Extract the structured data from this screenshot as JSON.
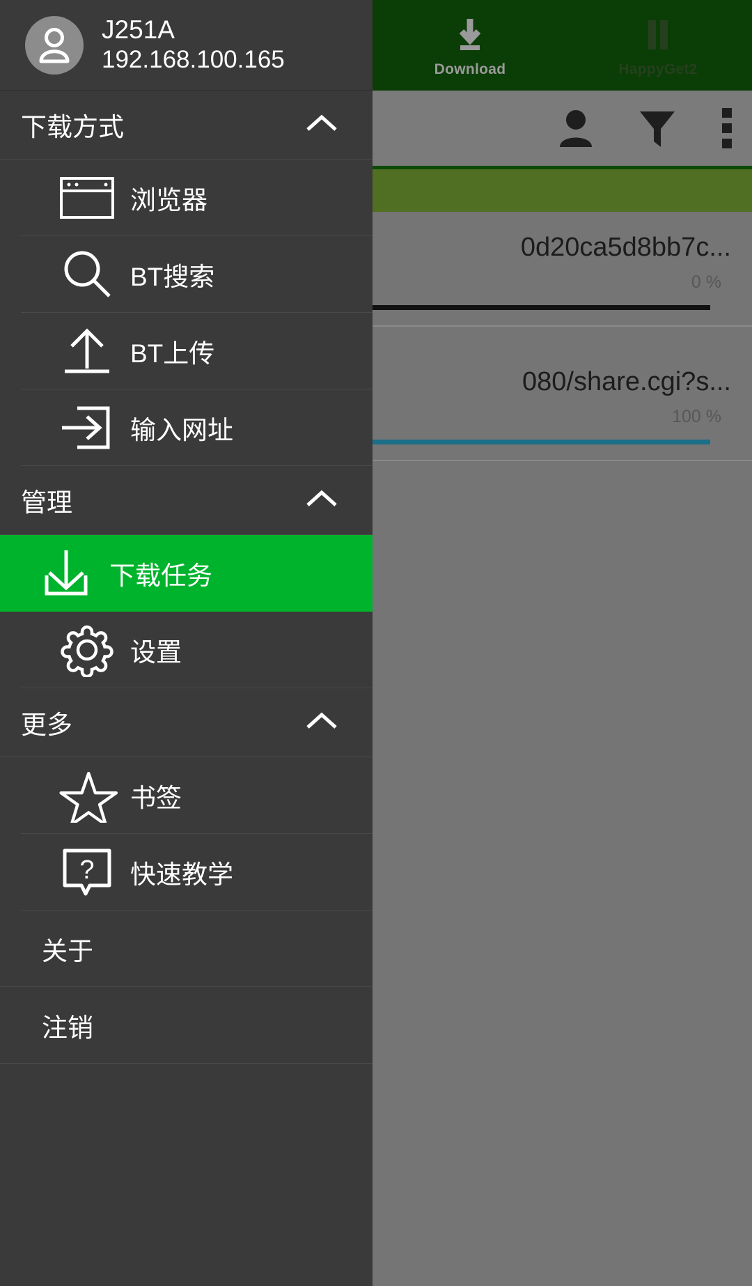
{
  "backdrop": {
    "tabs": [
      {
        "label": "Download",
        "icon": "download-arrow-icon",
        "active": true
      },
      {
        "label": "HappyGet2",
        "icon": "pause-bars-icon",
        "active": false
      }
    ],
    "toolbar_icons": [
      "person-icon",
      "filter-funnel-icon",
      "overflow-menu-icon"
    ],
    "tasks": [
      {
        "name": "0d20ca5d8bb7c...",
        "percent": "0 %",
        "bar_color": "#111111",
        "progress": 0
      },
      {
        "name": "080/share.cgi?s...",
        "percent": "100 %",
        "bar_color": "#1b6f88",
        "progress": 100
      }
    ]
  },
  "drawer": {
    "profile": {
      "name": "J251A",
      "ip": "192.168.100.165",
      "avatar_icon": "person-avatar-icon"
    },
    "sections": [
      {
        "title": "下载方式",
        "chevron": "chevron-up-icon",
        "items": [
          {
            "label": "浏览器",
            "icon": "browser-window-icon"
          },
          {
            "label": "BT搜索",
            "icon": "search-magnifier-icon"
          },
          {
            "label": "BT上传",
            "icon": "upload-arrow-icon"
          },
          {
            "label": "输入网址",
            "icon": "enter-url-icon"
          }
        ]
      },
      {
        "title": "管理",
        "chevron": "chevron-up-icon",
        "items": [
          {
            "label": "下载任务",
            "icon": "download-tray-icon",
            "selected": true
          },
          {
            "label": "设置",
            "icon": "gear-icon"
          }
        ]
      },
      {
        "title": "更多",
        "chevron": "chevron-up-icon",
        "items": [
          {
            "label": "书签",
            "icon": "star-outline-icon"
          },
          {
            "label": "快速教学",
            "icon": "question-bubble-icon"
          }
        ]
      }
    ],
    "footer_items": [
      {
        "label": "关于"
      },
      {
        "label": "注销"
      }
    ]
  },
  "colors": {
    "accent_green": "#00b32c",
    "drawer_bg": "#3a3a3a",
    "tabbar_green": "#0b3d06",
    "band_green": "#516f22",
    "scrim": "#757575"
  }
}
